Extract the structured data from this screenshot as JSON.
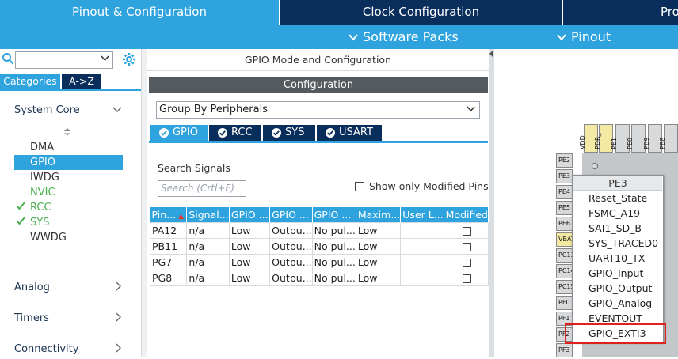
{
  "top_tabs": [
    {
      "label": "Pinout & Configuration",
      "active": true
    },
    {
      "label": "Clock Configuration",
      "active": false
    },
    {
      "label": "Pro",
      "active": false
    }
  ],
  "subbar": {
    "software_packs": "Software Packs",
    "pinout": "Pinout"
  },
  "left": {
    "search_value": "",
    "categories_tab": "Categories",
    "az_tab": "A->Z",
    "system_core": "System Core",
    "system_core_items": [
      {
        "label": "DMA",
        "state": "normal"
      },
      {
        "label": "GPIO",
        "state": "selected"
      },
      {
        "label": "IWDG",
        "state": "normal"
      },
      {
        "label": "NVIC",
        "state": "green"
      },
      {
        "label": "RCC",
        "state": "checked"
      },
      {
        "label": "SYS",
        "state": "checked"
      },
      {
        "label": "WWDG",
        "state": "normal"
      }
    ],
    "sections": [
      "Analog",
      "Timers",
      "Connectivity"
    ]
  },
  "middle": {
    "header": "GPIO Mode and Configuration",
    "config_bar": "Configuration",
    "group_by": "Group By Peripherals",
    "peripheral_tabs": [
      "GPIO",
      "RCC",
      "SYS",
      "USART"
    ],
    "search_label": "Search Signals",
    "search_placeholder": "Search (Crtl+F)",
    "show_only_modified": "Show only Modified Pins",
    "table": {
      "headers": [
        "Pin...",
        "Signal...",
        "GPIO ...",
        "GPIO ...",
        "GPIO ...",
        "Maxim...",
        "User L...",
        "Modified"
      ],
      "rows": [
        [
          "PA12",
          "n/a",
          "Low",
          "Outpu...",
          "No pul...",
          "Low",
          "",
          ""
        ],
        [
          "PB11",
          "n/a",
          "Low",
          "Outpu...",
          "No pul...",
          "Low",
          "",
          ""
        ],
        [
          "PG7",
          "n/a",
          "Low",
          "Outpu...",
          "No pul...",
          "Low",
          "",
          ""
        ],
        [
          "PG8",
          "n/a",
          "Low",
          "Outpu...",
          "No pul...",
          "Low",
          "",
          ""
        ]
      ]
    }
  },
  "chip": {
    "top_pins": [
      "VDD",
      "PDR_",
      "PE1",
      "PE0",
      "PB9",
      "PB8"
    ],
    "left_pins": [
      "PE2",
      "PE3",
      "PE4",
      "PE5",
      "PE6",
      "VBAT",
      "PC13",
      "PC14",
      "PC15",
      "PF0",
      "PF1",
      "PF2",
      "PF3"
    ]
  },
  "context_menu": {
    "title": "PE3",
    "items": [
      "Reset_State",
      "FSMC_A19",
      "SAI1_SD_B",
      "SYS_TRACED0",
      "UART10_TX",
      "GPIO_Input",
      "GPIO_Output",
      "GPIO_Analog",
      "EVENTOUT",
      "GPIO_EXTI3"
    ],
    "highlighted": "GPIO_EXTI3"
  },
  "colors": {
    "navy": "#0a2e5c",
    "accent_blue": "#2ea3de",
    "dark_gray_bar": "#555a5f",
    "highlight_red": "#e0201a"
  }
}
